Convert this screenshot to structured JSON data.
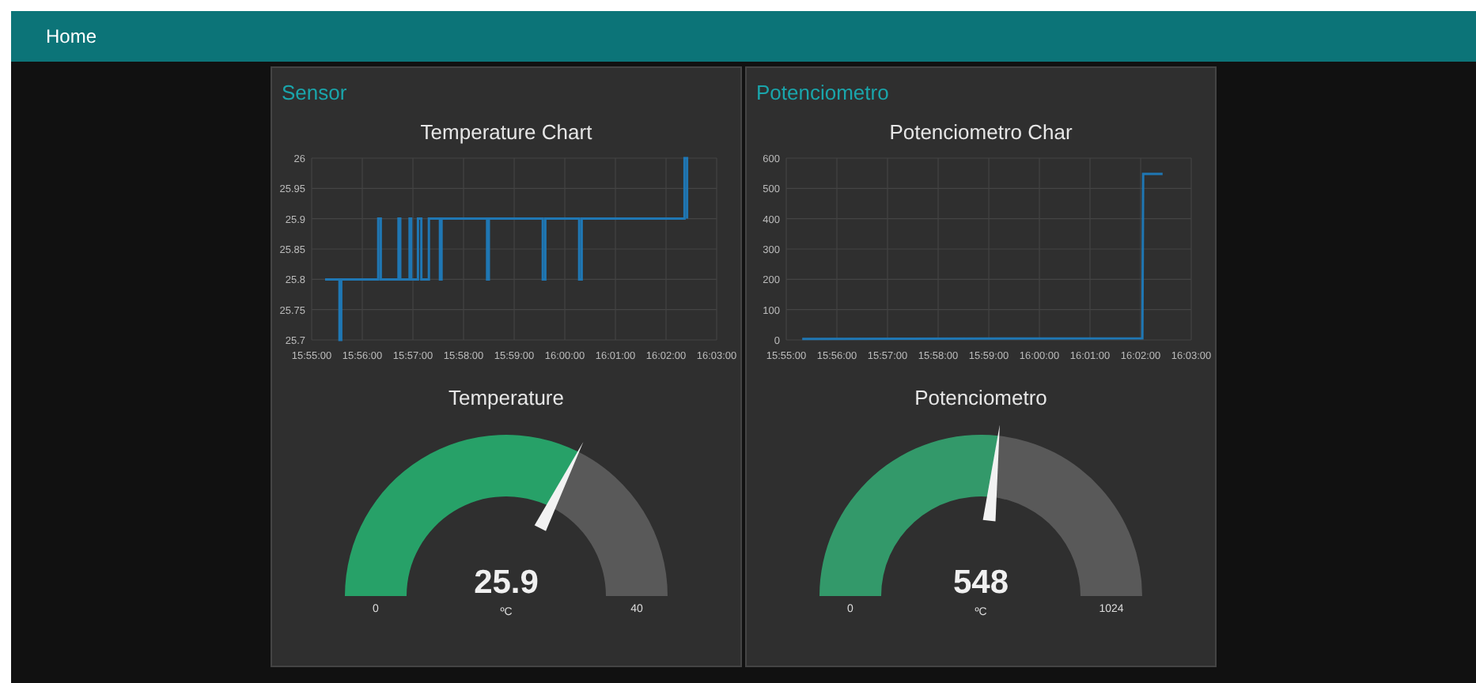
{
  "nav": {
    "title": "Home"
  },
  "cards": [
    {
      "title": "Sensor",
      "chart": {
        "chart_data": {
          "type": "line",
          "title": "Temperature Chart",
          "x": [
            57316,
            57333,
            57333,
            57335,
            57335,
            57379,
            57379,
            57382,
            57382,
            57403,
            57403,
            57405,
            57405,
            57416,
            57416,
            57418,
            57418,
            57426,
            57426,
            57430,
            57430,
            57439,
            57439,
            57452,
            57452,
            57454,
            57454,
            57508,
            57508,
            57510,
            57510,
            57574,
            57574,
            57577,
            57577,
            57617,
            57617,
            57620,
            57620,
            57742,
            57742,
            57745,
            57745
          ],
          "series": [
            {
              "color": "#1f77b4",
              "values": [
                25.8,
                25.8,
                25.7,
                25.7,
                25.8,
                25.8,
                25.9,
                25.9,
                25.8,
                25.8,
                25.9,
                25.9,
                25.8,
                25.8,
                25.9,
                25.9,
                25.8,
                25.8,
                25.9,
                25.9,
                25.8,
                25.8,
                25.9,
                25.9,
                25.8,
                25.8,
                25.9,
                25.9,
                25.8,
                25.8,
                25.9,
                25.9,
                25.8,
                25.8,
                25.9,
                25.9,
                25.8,
                25.8,
                25.9,
                25.9,
                26,
                26,
                25.9
              ]
            }
          ],
          "xlim": [
            57300,
            57780
          ],
          "ylim": [
            25.7,
            26
          ],
          "grid": true,
          "xticks": [
            {
              "value": 57300,
              "label": "15:55:00"
            },
            {
              "value": 57360,
              "label": "15:56:00"
            },
            {
              "value": 57420,
              "label": "15:57:00"
            },
            {
              "value": 57480,
              "label": "15:58:00"
            },
            {
              "value": 57540,
              "label": "15:59:00"
            },
            {
              "value": 57600,
              "label": "16:00:00"
            },
            {
              "value": 57660,
              "label": "16:01:00"
            },
            {
              "value": 57720,
              "label": "16:02:00"
            },
            {
              "value": 57780,
              "label": "16:03:00"
            }
          ],
          "yticks": [
            {
              "value": 25.7,
              "label": "25.7"
            },
            {
              "value": 25.75,
              "label": "25.75"
            },
            {
              "value": 25.8,
              "label": "25.8"
            },
            {
              "value": 25.85,
              "label": "25.85"
            },
            {
              "value": 25.9,
              "label": "25.9"
            },
            {
              "value": 25.95,
              "label": "25.95"
            },
            {
              "value": 26,
              "label": "26"
            }
          ]
        }
      },
      "gauge": {
        "title": "Temperature",
        "value": "25.9",
        "unit": "ºC",
        "min": "0",
        "max": "40",
        "level": 0.6475,
        "color": "#27a168"
      }
    },
    {
      "title": "Potenciometro",
      "chart": {
        "chart_data": {
          "type": "line",
          "title": "Potenciometro Char",
          "x": [
            57319,
            57722,
            57723,
            57746
          ],
          "series": [
            {
              "color": "#1f77b4",
              "values": [
                3,
                5,
                548,
                548
              ]
            }
          ],
          "xlim": [
            57300,
            57780
          ],
          "ylim": [
            0,
            600
          ],
          "grid": true,
          "xticks": [
            {
              "value": 57300,
              "label": "15:55:00"
            },
            {
              "value": 57360,
              "label": "15:56:00"
            },
            {
              "value": 57420,
              "label": "15:57:00"
            },
            {
              "value": 57480,
              "label": "15:58:00"
            },
            {
              "value": 57540,
              "label": "15:59:00"
            },
            {
              "value": 57600,
              "label": "16:00:00"
            },
            {
              "value": 57660,
              "label": "16:01:00"
            },
            {
              "value": 57720,
              "label": "16:02:00"
            },
            {
              "value": 57780,
              "label": "16:03:00"
            }
          ],
          "yticks": [
            {
              "value": 0,
              "label": "0"
            },
            {
              "value": 100,
              "label": "100"
            },
            {
              "value": 200,
              "label": "200"
            },
            {
              "value": 300,
              "label": "300"
            },
            {
              "value": 400,
              "label": "400"
            },
            {
              "value": 500,
              "label": "500"
            },
            {
              "value": 600,
              "label": "600"
            }
          ]
        }
      },
      "gauge": {
        "title": "Potenciometro",
        "value": "548",
        "unit": "ºC",
        "min": "0",
        "max": "1024",
        "level": 0.535,
        "color": "#33996a"
      }
    }
  ]
}
